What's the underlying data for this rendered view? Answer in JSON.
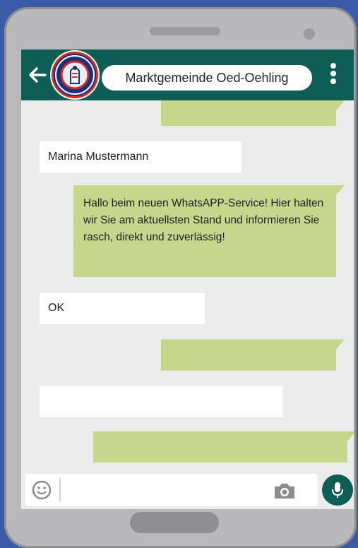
{
  "header": {
    "title": "Marktgemeinde Oed-Oehling",
    "back_icon": "arrow-left-icon",
    "menu_icon": "more-vertical-icon",
    "avatar_icon": "municipal-crest-icon"
  },
  "messages": [
    {
      "direction": "outgoing",
      "text": ""
    },
    {
      "direction": "incoming",
      "text": "Marina Mustermann"
    },
    {
      "direction": "outgoing",
      "text": "Hallo beim neuen WhatsAPP-Service! Hier halten wir Sie am aktuellsten Stand und informieren Sie rasch, direkt und zuverlässig!"
    },
    {
      "direction": "incoming",
      "text": "OK"
    },
    {
      "direction": "outgoing",
      "text": ""
    },
    {
      "direction": "incoming",
      "text": ""
    },
    {
      "direction": "outgoing",
      "text": ""
    }
  ],
  "composer": {
    "value": "",
    "emoji_icon": "emoji-icon",
    "camera_icon": "camera-icon",
    "mic_icon": "microphone-icon"
  },
  "colors": {
    "background": "#3a5ba8",
    "appbar": "#0f5e55",
    "outgoing_bubble": "#c6d68c",
    "incoming_bubble": "#ffffff",
    "chat_background": "#ececec"
  }
}
